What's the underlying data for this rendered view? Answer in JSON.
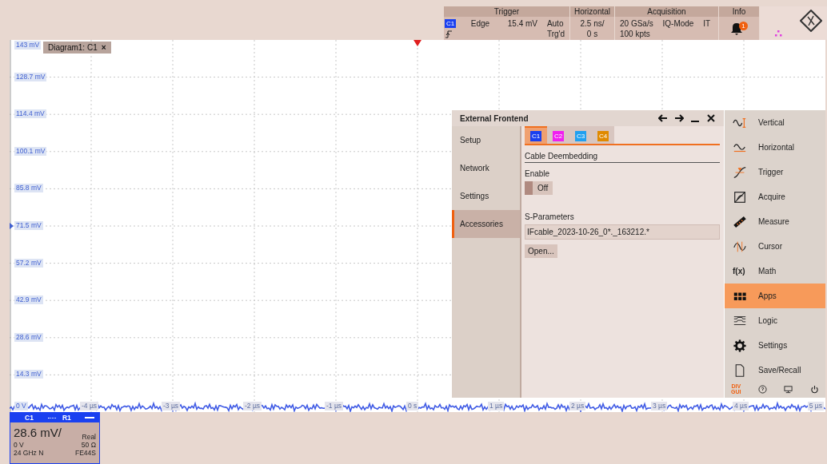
{
  "toolbar": {
    "trigger": {
      "title": "Trigger",
      "source": "C1",
      "type": "Edge",
      "trigger_level": "15.4 mV",
      "mode": "Auto",
      "state": "Trg'd"
    },
    "horizontal": {
      "title": "Horizontal",
      "scale": "2.5 ns/",
      "position": "0 s"
    },
    "acquisition": {
      "title": "Acquisition",
      "sample_rate": "20 GSa/s",
      "mode": "IQ-Mode",
      "flag": "IT",
      "record_length": "100 kpts"
    },
    "info": {
      "title": "Info",
      "notifications": "1"
    }
  },
  "diagram": {
    "tab": "Diagram1: C1",
    "close": "×",
    "y_labels": [
      "143 mV",
      "128.7 mV",
      "114.4 mV",
      "100.1 mV",
      "85.8 mV",
      "71.5 mV",
      "57.2 mV",
      "42.9 mV",
      "28.6 mV",
      "14.3 mV",
      "0 V"
    ],
    "x_labels": [
      "-4 µs",
      "-3 µs",
      "-2 µs",
      "-1 µs",
      "0 s",
      "1 µs",
      "2 µs",
      "3 µs",
      "4 µs",
      "5 µs"
    ]
  },
  "dialog": {
    "title": "External Frontend",
    "nav": [
      {
        "label": "Setup",
        "selected": false
      },
      {
        "label": "Network",
        "selected": false
      },
      {
        "label": "Settings",
        "selected": false
      },
      {
        "label": "Accessories",
        "selected": true
      }
    ],
    "channel_tabs": [
      {
        "label": "C1",
        "color": "#1a40f0",
        "selected": true
      },
      {
        "label": "C2",
        "color": "#f020f0",
        "selected": false
      },
      {
        "label": "C3",
        "color": "#20a0f0",
        "selected": false
      },
      {
        "label": "C4",
        "color": "#e08a00",
        "selected": false
      }
    ],
    "section": "Cable Deembedding",
    "enable_label": "Enable",
    "toggle": {
      "label": "Off",
      "on": false
    },
    "sparam_label": "S-Parameters",
    "file_value": "IFcable_2023-10-26_0*._163212.*",
    "open_button": "Open..."
  },
  "menu": {
    "items": [
      {
        "label": "Vertical",
        "kind": "vertical",
        "selected": false
      },
      {
        "label": "Horizontal",
        "kind": "horizontal",
        "selected": false
      },
      {
        "label": "Trigger",
        "kind": "trigger",
        "selected": false
      },
      {
        "label": "Acquire",
        "kind": "acquire",
        "selected": false
      },
      {
        "label": "Measure",
        "kind": "measure",
        "selected": false
      },
      {
        "label": "Cursor",
        "kind": "cursor",
        "selected": false
      },
      {
        "label": "Math",
        "kind": "math",
        "icon_text": "f(x)",
        "selected": false
      },
      {
        "label": "Apps",
        "kind": "apps",
        "selected": true
      },
      {
        "label": "Logic",
        "kind": "logic",
        "selected": false
      },
      {
        "label": "Settings",
        "kind": "settings",
        "selected": false
      },
      {
        "label": "Save/Recall",
        "kind": "file",
        "selected": false
      }
    ],
    "div_gui": [
      "DIV",
      "GUI"
    ]
  },
  "channel_card": {
    "channel": "C1",
    "reference": "R1",
    "scale": "28.6 mV/",
    "offset": "0 V",
    "bandwidth": "24 GHz N",
    "mode": "Real",
    "impedance": "50 Ω",
    "probe": "FE44S"
  }
}
